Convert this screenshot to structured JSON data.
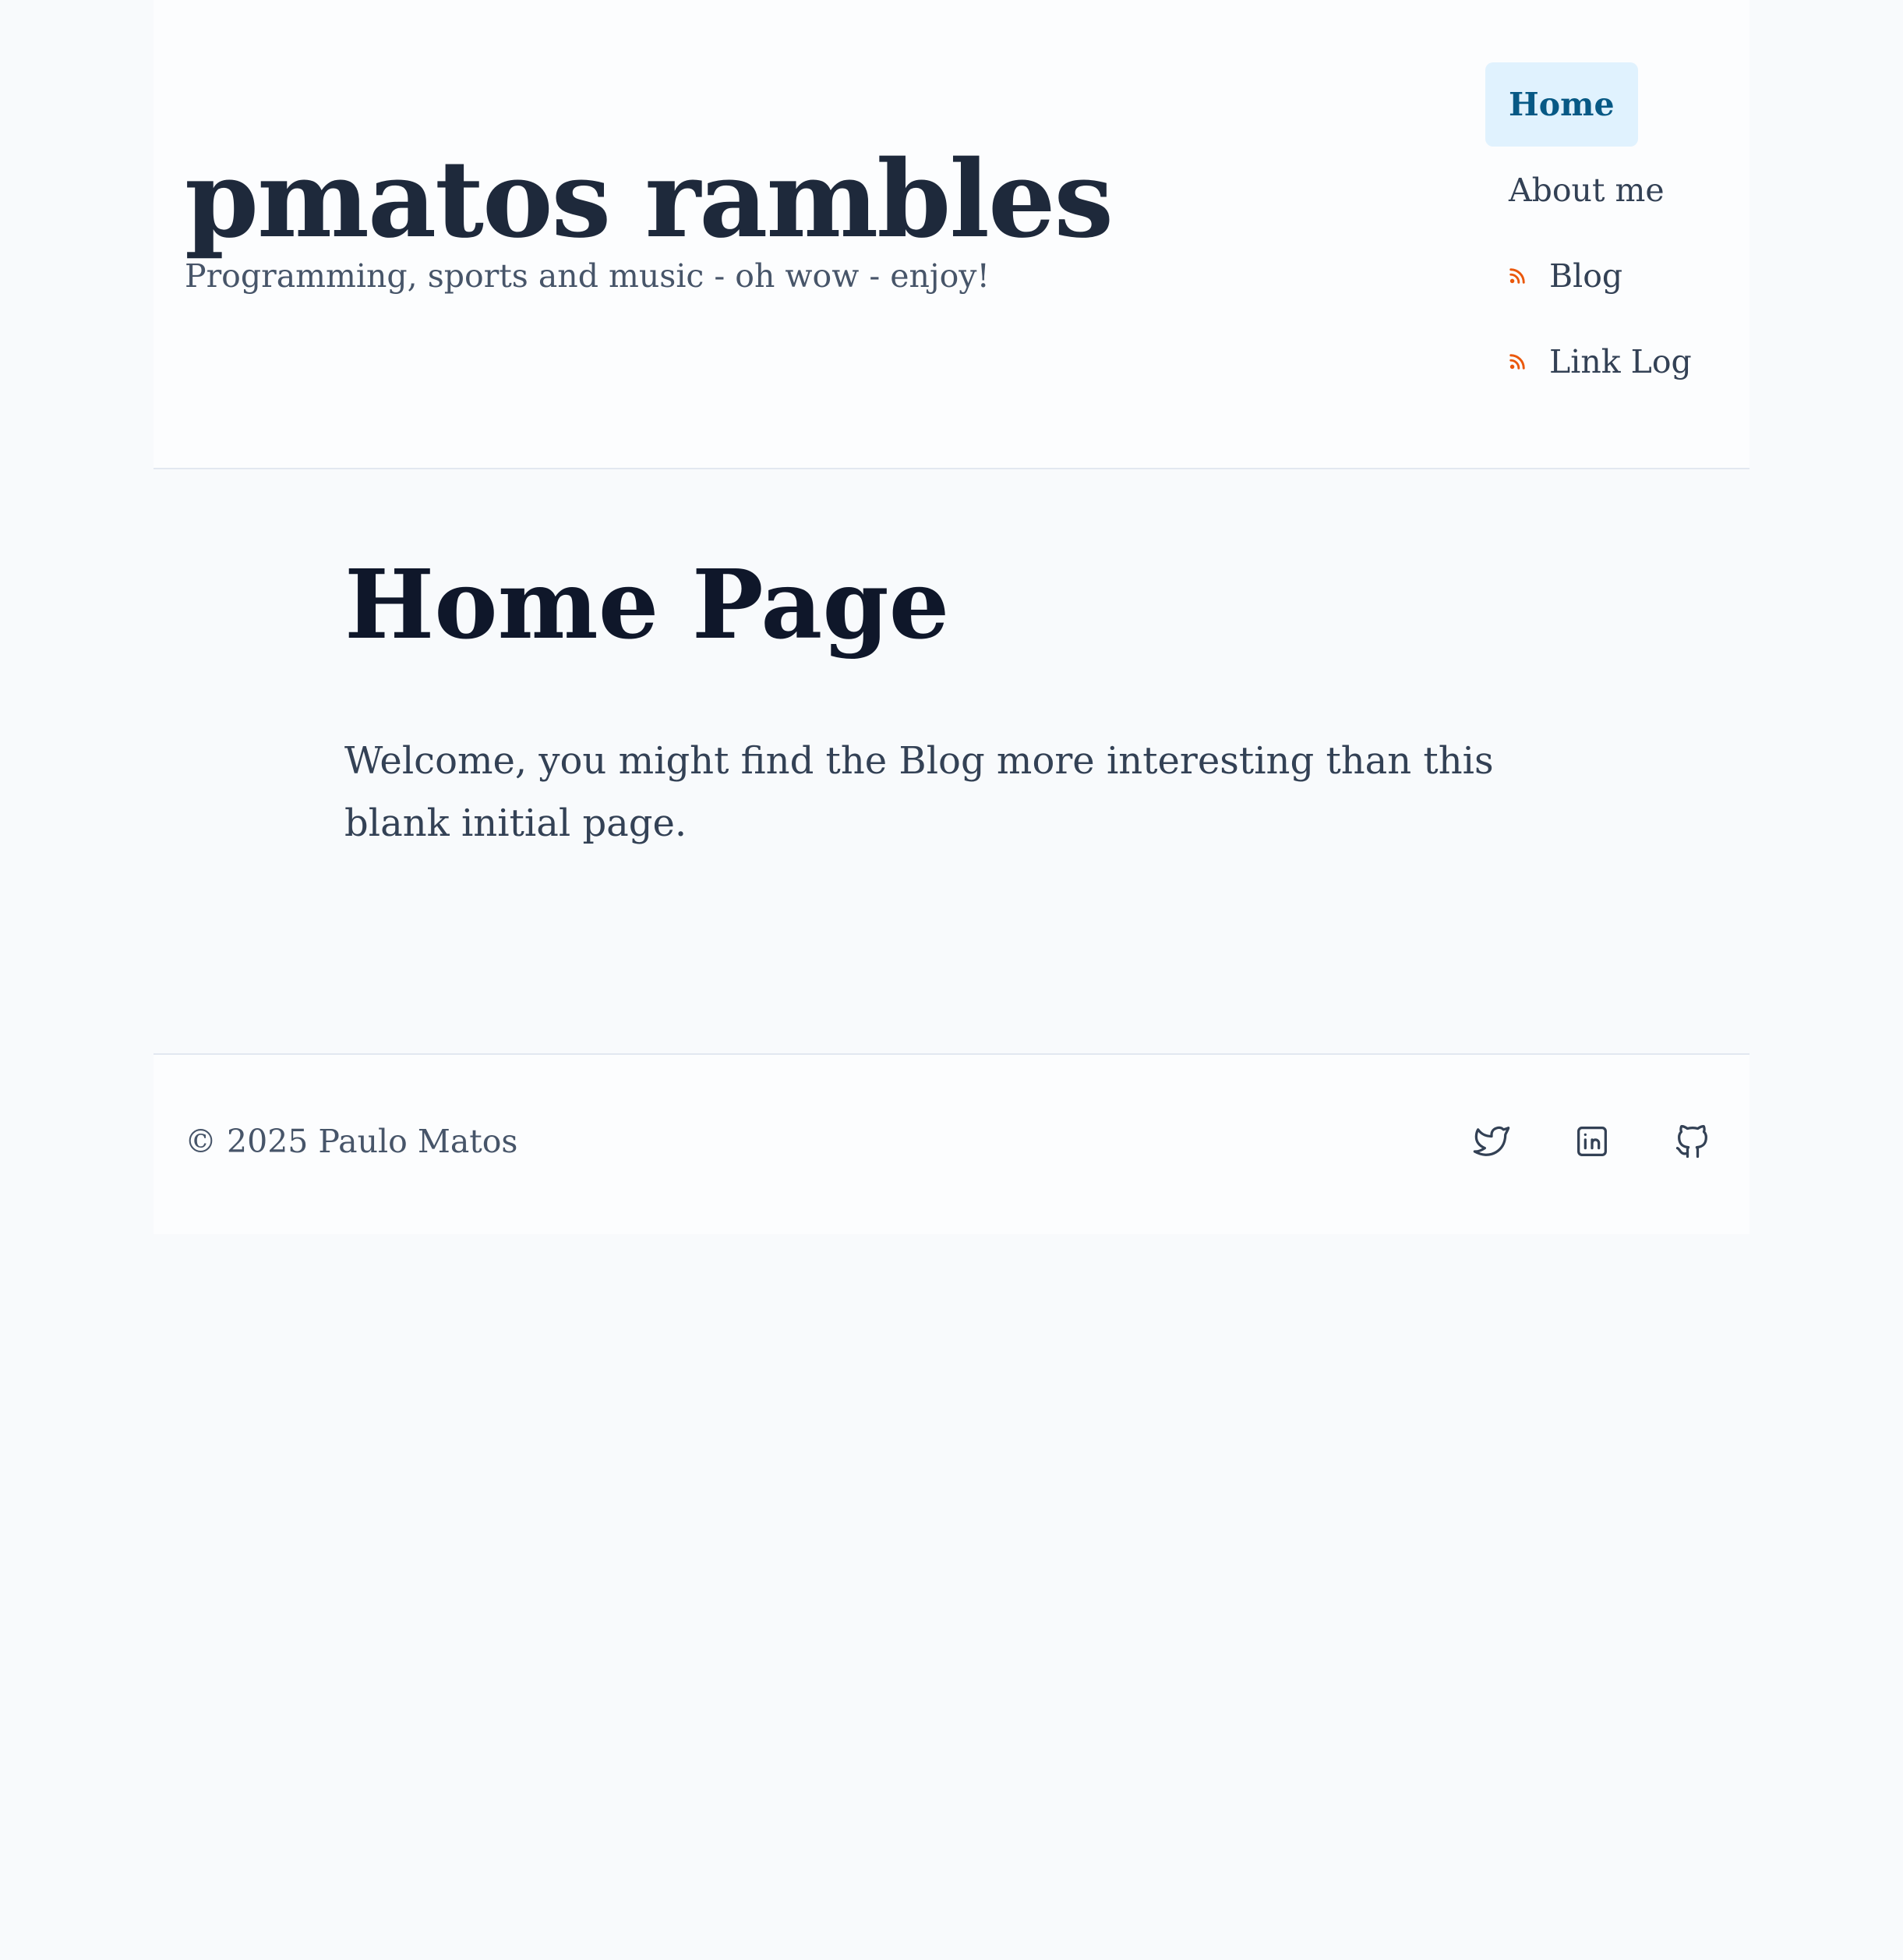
{
  "site": {
    "title": "pmatos rambles",
    "tagline": "Programming, sports and music - oh wow - enjoy!"
  },
  "nav": {
    "items": [
      {
        "label": "Home",
        "active": true,
        "rss": false
      },
      {
        "label": "About me",
        "active": false,
        "rss": false
      },
      {
        "label": "Blog",
        "active": false,
        "rss": true
      },
      {
        "label": "Link Log",
        "active": false,
        "rss": true
      }
    ]
  },
  "main": {
    "title": "Home Page",
    "body": "Welcome, you might find the Blog more interesting than this blank initial page."
  },
  "footer": {
    "copyright": "© 2025 Paulo Matos",
    "social": [
      {
        "icon": "twitter-icon"
      },
      {
        "icon": "linkedin-icon"
      },
      {
        "icon": "github-icon"
      }
    ]
  },
  "colors": {
    "accent": "#075985",
    "active_bg": "#e0f2fe",
    "rss": "#ea580c",
    "text": "#334155"
  }
}
